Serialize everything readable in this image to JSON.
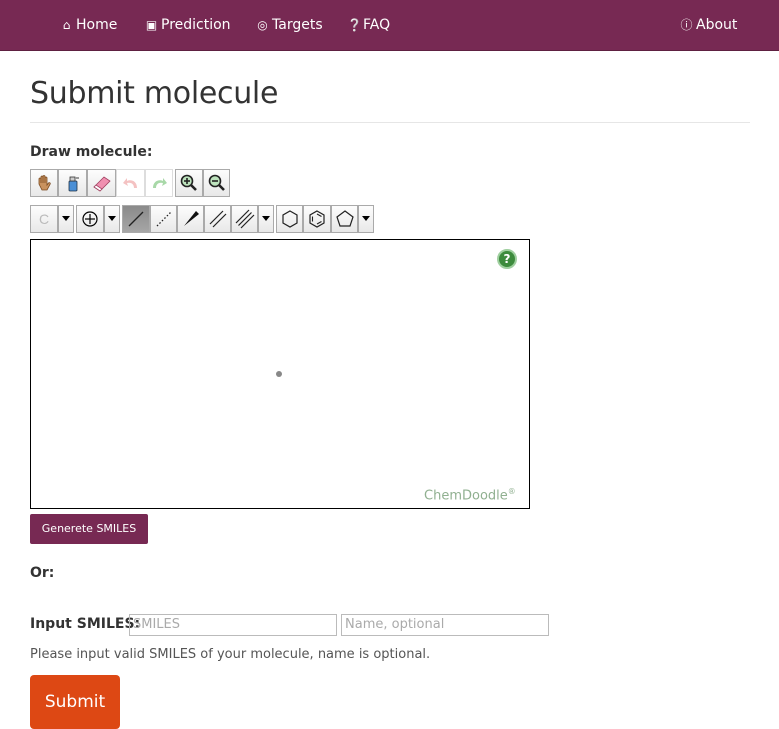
{
  "nav": {
    "home": "Home",
    "prediction": "Prediction",
    "targets": "Targets",
    "faq": "FAQ",
    "about": "About"
  },
  "page": {
    "title": "Submit molecule"
  },
  "draw": {
    "label": "Draw molecule:",
    "element_label": "C",
    "brand": "ChemDoodle",
    "brand_mark": "®",
    "help_glyph": "?"
  },
  "generate_button": "Generete SMILES",
  "or_label": "Or:",
  "smiles": {
    "label": "Input SMILES:",
    "smiles_placeholder": "SMILES",
    "name_placeholder": "Name, optional",
    "help": "Please input valid SMILES of your molecule, name is optional."
  },
  "submit_label": "Submit",
  "colors": {
    "navbar": "#772953",
    "submit": "#dd4814",
    "generate": "#772953"
  }
}
